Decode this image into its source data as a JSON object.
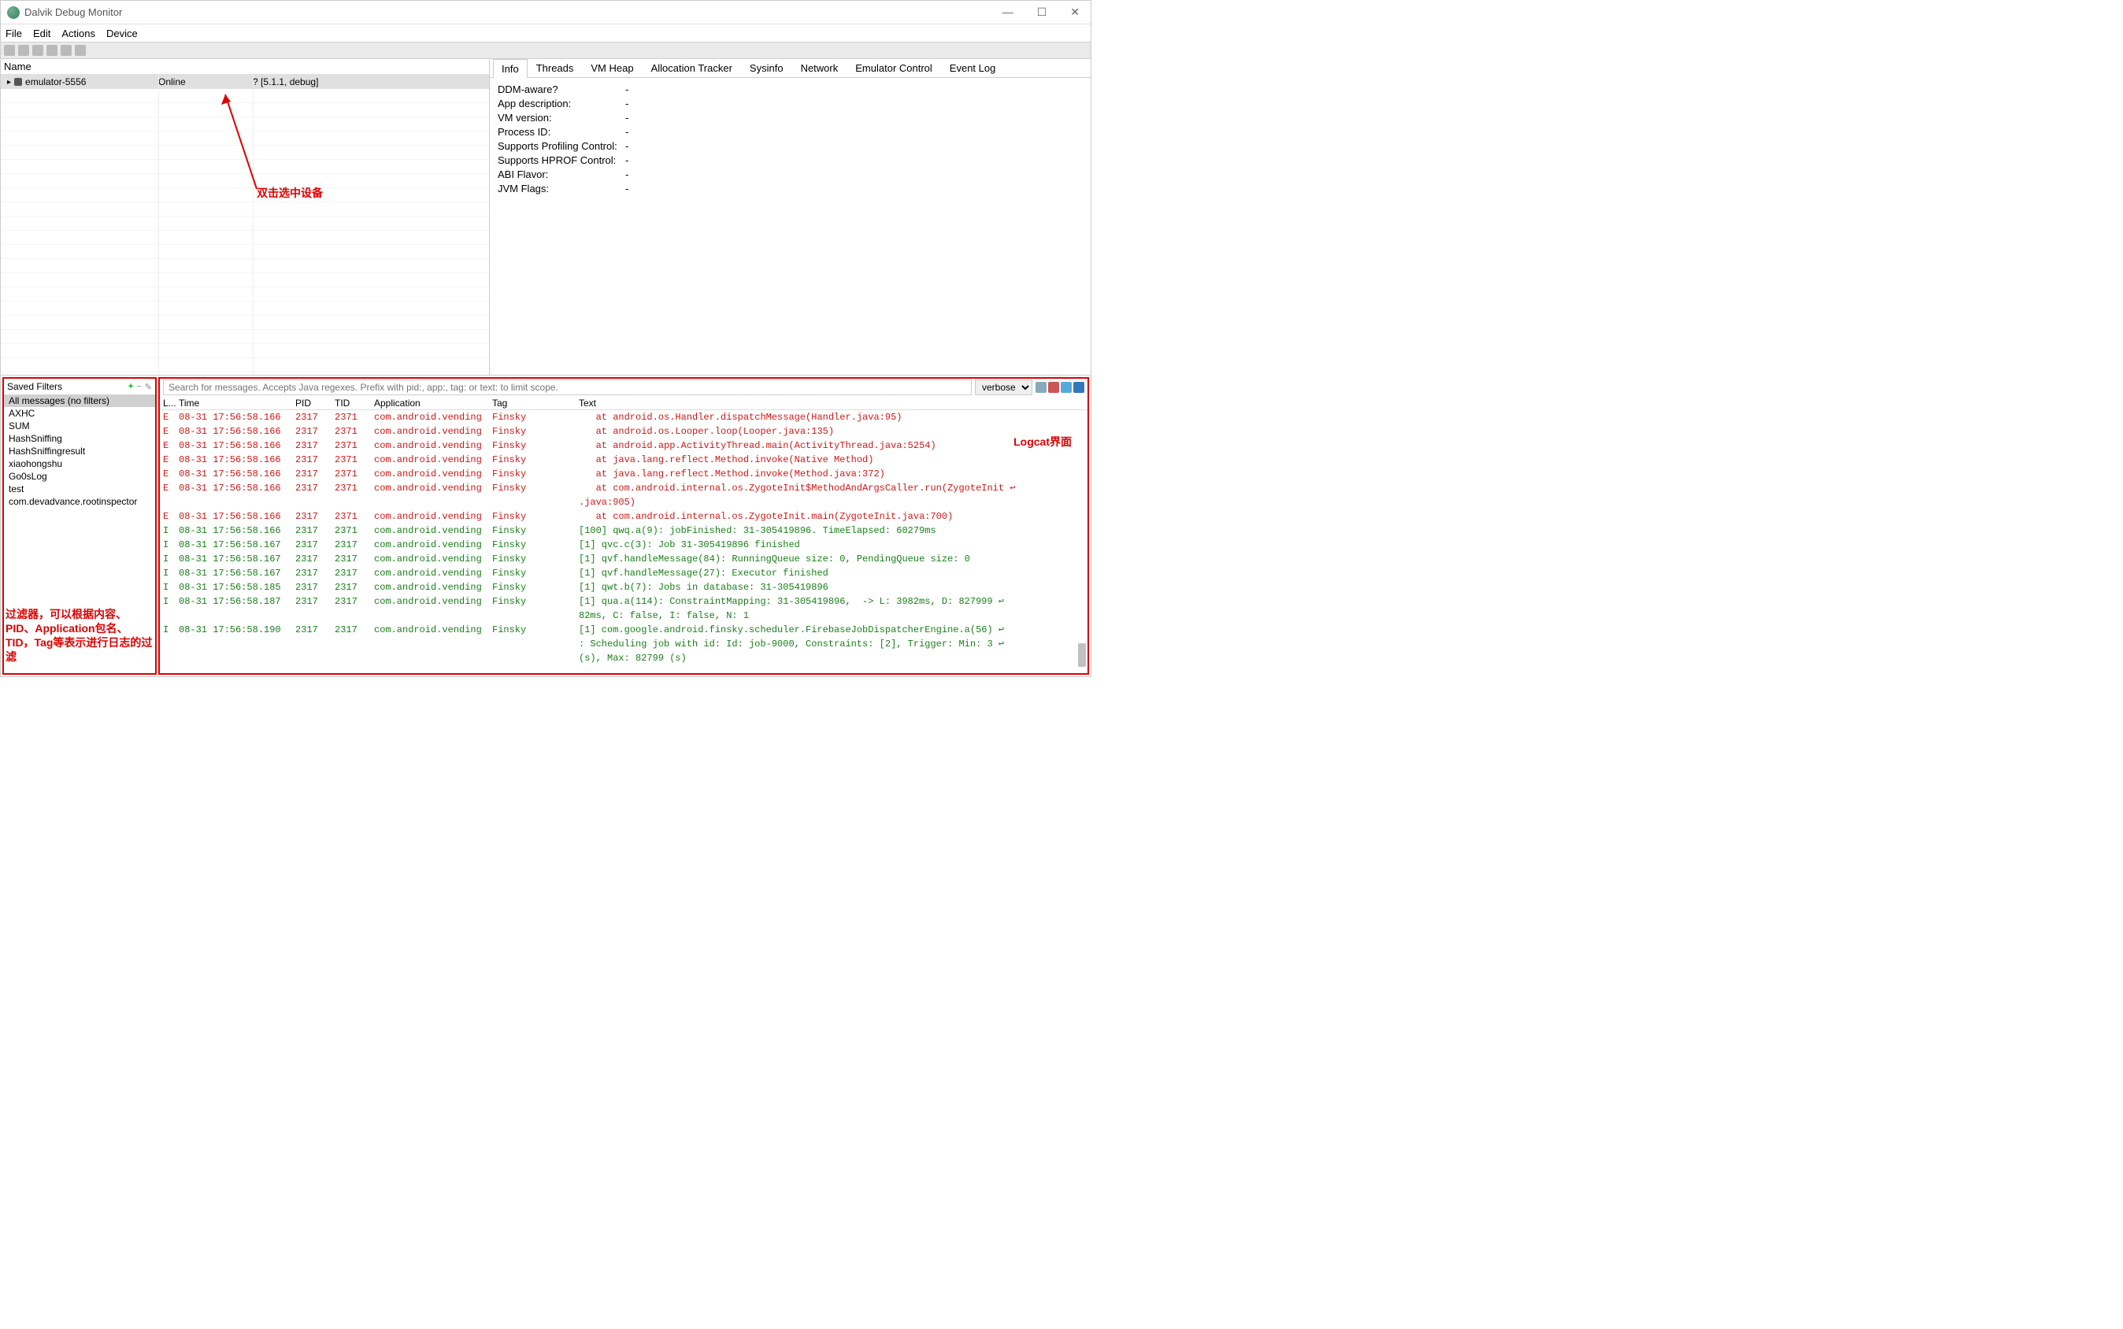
{
  "window": {
    "title": "Dalvik Debug Monitor"
  },
  "menu": [
    "File",
    "Edit",
    "Actions",
    "Device"
  ],
  "device_table": {
    "header": "Name",
    "row": {
      "name": "emulator-5556",
      "status": "Online",
      "info": "? [5.1.1, debug]"
    }
  },
  "info_tabs": [
    "Info",
    "Threads",
    "VM Heap",
    "Allocation Tracker",
    "Sysinfo",
    "Network",
    "Emulator Control",
    "Event Log"
  ],
  "info_rows": [
    {
      "k": "DDM-aware?",
      "v": "-"
    },
    {
      "k": "App description:",
      "v": "-"
    },
    {
      "k": "VM version:",
      "v": "-"
    },
    {
      "k": "Process ID:",
      "v": "-"
    },
    {
      "k": "Supports Profiling Control:",
      "v": "-"
    },
    {
      "k": "Supports HPROF Control:",
      "v": "-"
    },
    {
      "k": "ABI Flavor:",
      "v": "-"
    },
    {
      "k": "JVM Flags:",
      "v": "-"
    }
  ],
  "filters": {
    "title": "Saved Filters",
    "items": [
      "All messages (no filters)",
      "AXHC",
      "SUM",
      "HashSniffing",
      "HashSniffingresult",
      "xiaohongshu",
      "Go0sLog",
      "test",
      "com.devadvance.rootinspector"
    ]
  },
  "log": {
    "placeholder": "Search for messages. Accepts Java regexes. Prefix with pid:, app:, tag: or text: to limit scope.",
    "level": "verbose",
    "cols": [
      "L...",
      "Time",
      "PID",
      "TID",
      "Application",
      "Tag",
      "Text"
    ],
    "rows": [
      {
        "l": "E",
        "t": "08-31 17:56:58.166",
        "pid": "2317",
        "tid": "2371",
        "app": "com.android.vending",
        "tag": "Finsky",
        "text": "   at android.os.Handler.dispatchMessage(Handler.java:95)"
      },
      {
        "l": "E",
        "t": "08-31 17:56:58.166",
        "pid": "2317",
        "tid": "2371",
        "app": "com.android.vending",
        "tag": "Finsky",
        "text": "   at android.os.Looper.loop(Looper.java:135)"
      },
      {
        "l": "E",
        "t": "08-31 17:56:58.166",
        "pid": "2317",
        "tid": "2371",
        "app": "com.android.vending",
        "tag": "Finsky",
        "text": "   at android.app.ActivityThread.main(ActivityThread.java:5254)"
      },
      {
        "l": "E",
        "t": "08-31 17:56:58.166",
        "pid": "2317",
        "tid": "2371",
        "app": "com.android.vending",
        "tag": "Finsky",
        "text": "   at java.lang.reflect.Method.invoke(Native Method)"
      },
      {
        "l": "E",
        "t": "08-31 17:56:58.166",
        "pid": "2317",
        "tid": "2371",
        "app": "com.android.vending",
        "tag": "Finsky",
        "text": "   at java.lang.reflect.Method.invoke(Method.java:372)"
      },
      {
        "l": "E",
        "t": "08-31 17:56:58.166",
        "pid": "2317",
        "tid": "2371",
        "app": "com.android.vending",
        "tag": "Finsky",
        "text": "   at com.android.internal.os.ZygoteInit$MethodAndArgsCaller.run(ZygoteInit ↩\n.java:905)"
      },
      {
        "l": "E",
        "t": "08-31 17:56:58.166",
        "pid": "2317",
        "tid": "2371",
        "app": "com.android.vending",
        "tag": "Finsky",
        "text": "   at com.android.internal.os.ZygoteInit.main(ZygoteInit.java:700)"
      },
      {
        "l": "I",
        "t": "08-31 17:56:58.166",
        "pid": "2317",
        "tid": "2371",
        "app": "com.android.vending",
        "tag": "Finsky",
        "text": "[100] qwq.a(9): jobFinished: 31-305419896. TimeElapsed: 60279ms"
      },
      {
        "l": "I",
        "t": "08-31 17:56:58.167",
        "pid": "2317",
        "tid": "2317",
        "app": "com.android.vending",
        "tag": "Finsky",
        "text": "[1] qvc.c(3): Job 31-305419896 finished"
      },
      {
        "l": "I",
        "t": "08-31 17:56:58.167",
        "pid": "2317",
        "tid": "2317",
        "app": "com.android.vending",
        "tag": "Finsky",
        "text": "[1] qvf.handleMessage(84): RunningQueue size: 0, PendingQueue size: 0"
      },
      {
        "l": "I",
        "t": "08-31 17:56:58.167",
        "pid": "2317",
        "tid": "2317",
        "app": "com.android.vending",
        "tag": "Finsky",
        "text": "[1] qvf.handleMessage(27): Executor finished"
      },
      {
        "l": "I",
        "t": "08-31 17:56:58.185",
        "pid": "2317",
        "tid": "2317",
        "app": "com.android.vending",
        "tag": "Finsky",
        "text": "[1] qwt.b(7): Jobs in database: 31-305419896"
      },
      {
        "l": "I",
        "t": "08-31 17:56:58.187",
        "pid": "2317",
        "tid": "2317",
        "app": "com.android.vending",
        "tag": "Finsky",
        "text": "[1] qua.a(114): ConstraintMapping: 31-305419896,  -> L: 3982ms, D: 827999 ↩\n82ms, C: false, I: false, N: 1"
      },
      {
        "l": "I",
        "t": "08-31 17:56:58.190",
        "pid": "2317",
        "tid": "2317",
        "app": "com.android.vending",
        "tag": "Finsky",
        "text": "[1] com.google.android.finsky.scheduler.FirebaseJobDispatcherEngine.a(56) ↩\n: Scheduling job with id: Id: job-9000, Constraints: [2], Trigger: Min: 3 ↩\n(s), Max: 82799 (s)"
      }
    ]
  },
  "annotations": {
    "device_hint": "双击选中设备",
    "filter_hint": "过滤器，可以根据内容、PID、Application包名、TID，Tag等表示进行日志的过滤",
    "logcat_hint": "Logcat界面"
  }
}
